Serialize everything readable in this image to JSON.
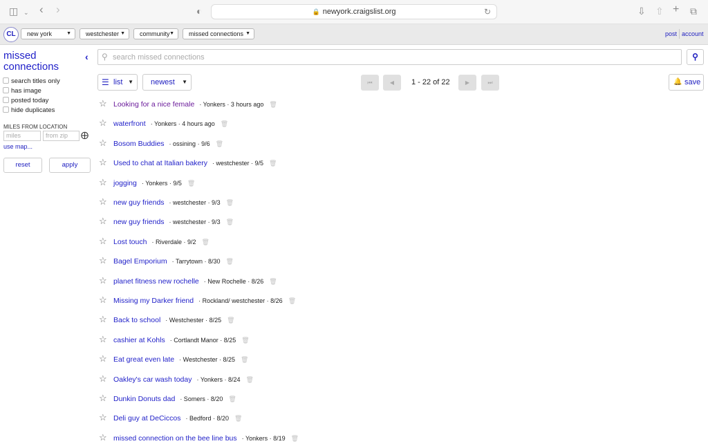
{
  "browser": {
    "url": "newyork.craigslist.org"
  },
  "header": {
    "logo": "CL",
    "crumbs": [
      "new york",
      "westchester",
      "community",
      "missed connections"
    ],
    "post_link": "post",
    "account_link": "account"
  },
  "sidebar": {
    "title": "missed connections",
    "filters": [
      "search titles only",
      "has image",
      "posted today",
      "hide duplicates"
    ],
    "miles_label": "MILES FROM LOCATION",
    "miles_placeholder": "miles",
    "zip_placeholder": "from zip",
    "use_map": "use map...",
    "reset": "reset",
    "apply": "apply"
  },
  "search": {
    "placeholder": "search missed connections"
  },
  "controls": {
    "view": "list",
    "sort": "newest",
    "range": "1 - 22 of 22",
    "save": "save"
  },
  "listings": [
    {
      "title": "Looking for a nice female",
      "meta": "· Yonkers · 3 hours ago",
      "visited": true
    },
    {
      "title": "waterfront",
      "meta": "· Yonkers · 4 hours ago",
      "visited": false
    },
    {
      "title": "Bosom Buddies",
      "meta": "· ossining · 9/6",
      "visited": false
    },
    {
      "title": "Used to chat at Italian bakery",
      "meta": "· westchester · 9/5",
      "visited": false
    },
    {
      "title": "jogging",
      "meta": "· Yonkers · 9/5",
      "visited": false
    },
    {
      "title": "new guy friends",
      "meta": "· westchester · 9/3",
      "visited": false
    },
    {
      "title": "new guy friends",
      "meta": "· westchester · 9/3",
      "visited": false
    },
    {
      "title": "Lost touch",
      "meta": "· Riverdale · 9/2",
      "visited": false
    },
    {
      "title": "Bagel Emporium",
      "meta": "· Tarrytown · 8/30",
      "visited": false
    },
    {
      "title": "planet fitness new rochelle",
      "meta": "· New Rochelle · 8/26",
      "visited": false
    },
    {
      "title": "Missing my Darker friend",
      "meta": "· Rockland/ westchester · 8/26",
      "visited": false
    },
    {
      "title": "Back to school",
      "meta": "· Westchester · 8/25",
      "visited": false
    },
    {
      "title": "cashier at Kohls",
      "meta": "· Cortlandt Manor · 8/25",
      "visited": false
    },
    {
      "title": "Eat great even late",
      "meta": "· Westchester · 8/25",
      "visited": false
    },
    {
      "title": "Oakley's car wash today",
      "meta": "· Yonkers · 8/24",
      "visited": false
    },
    {
      "title": "Dunkin Donuts dad",
      "meta": "· Somers · 8/20",
      "visited": false
    },
    {
      "title": "Deli guy at DeCiccos",
      "meta": "· Bedford · 8/20",
      "visited": false
    },
    {
      "title": "missed connection on the bee line bus",
      "meta": "· Yonkers · 8/19",
      "visited": false
    }
  ]
}
